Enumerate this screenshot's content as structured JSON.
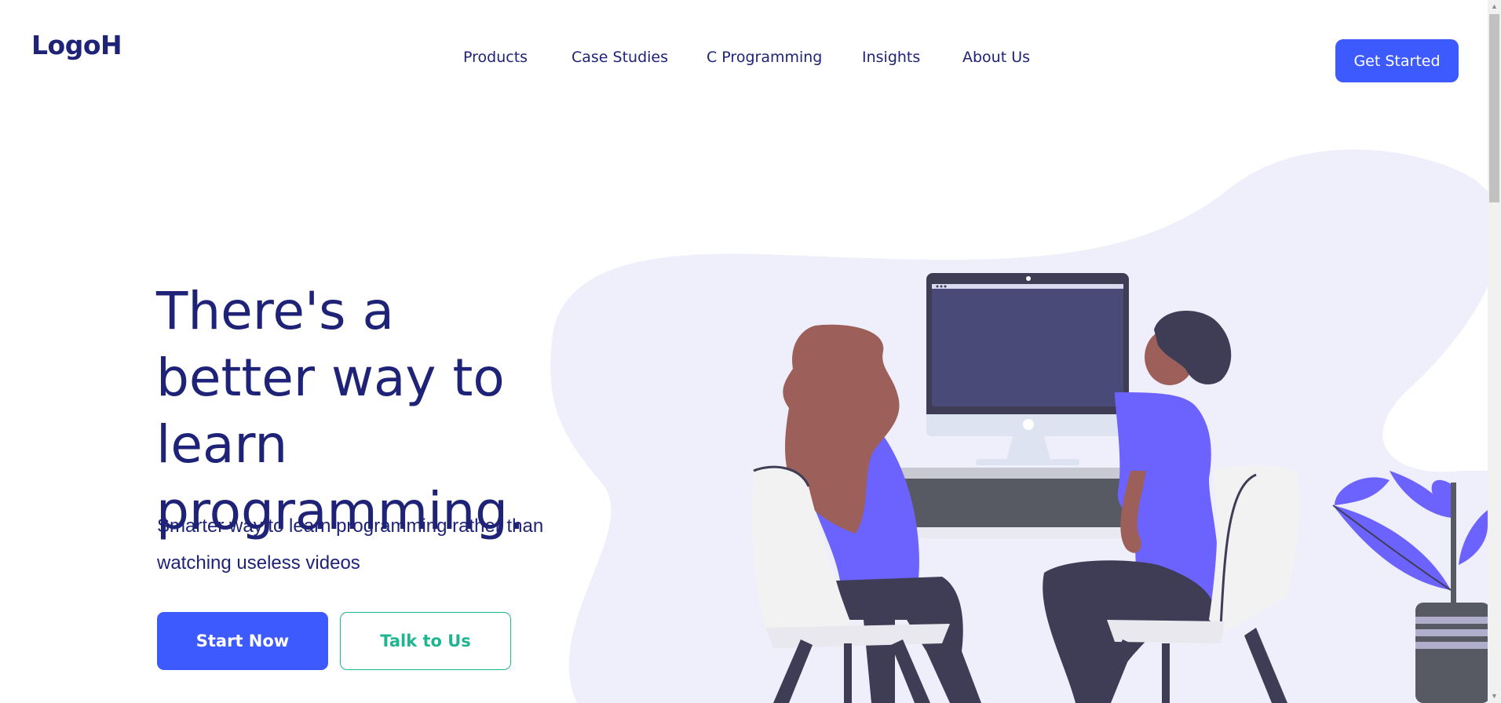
{
  "header": {
    "logo": "LogoH",
    "nav": [
      "Products",
      "Case Studies",
      "C Programming",
      "Insights",
      "About Us"
    ],
    "cta_label": "Get Started"
  },
  "hero": {
    "headline": "There's a better way to learn programming.",
    "subtext": "Smarter way to learn programming rather than watching useless videos",
    "primary_button": "Start Now",
    "secondary_button": "Talk to Us"
  },
  "colors": {
    "brand_dark": "#1e2378",
    "accent_blue": "#3d5afe",
    "accent_green": "#1fb592",
    "blob": "#efeffb",
    "figure_purple": "#6c63ff"
  },
  "icons": [
    "scroll-up-arrow-icon",
    "scroll-down-arrow-icon"
  ]
}
